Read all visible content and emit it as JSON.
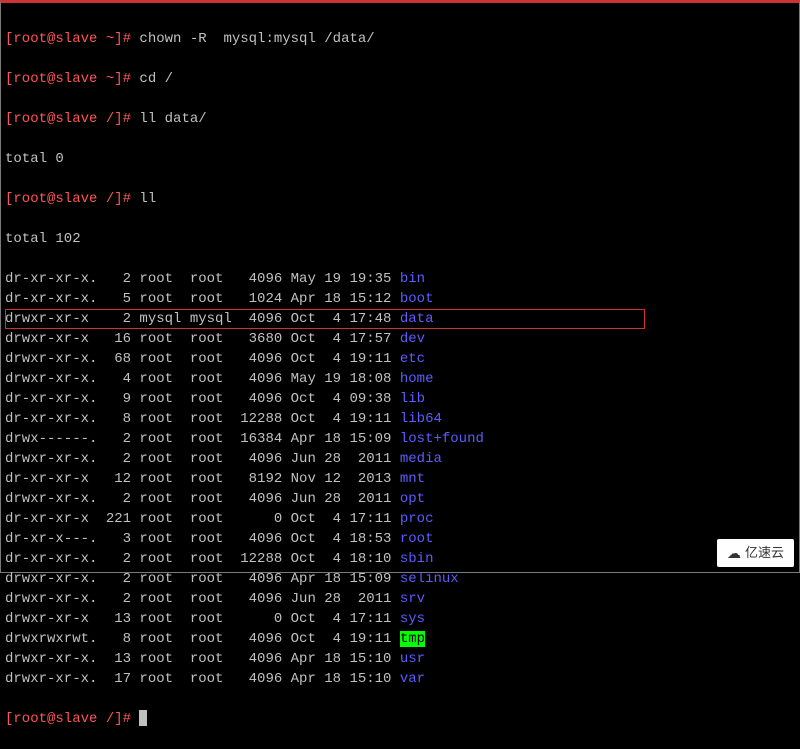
{
  "prompts": [
    {
      "user": "[root@slave ~]#",
      "cmd": " chown -R  mysql:mysql /data/"
    },
    {
      "user": "[root@slave ~]#",
      "cmd": " cd /"
    },
    {
      "user": "[root@slave /]#",
      "cmd": " ll data/"
    }
  ],
  "total_data": "total 0",
  "prompt_ll": {
    "user": "[root@slave /]#",
    "cmd": " ll"
  },
  "total_root": "total 102",
  "rows": [
    {
      "perm": "dr-xr-xr-x.   2 root  root   4096 May 19 19:35 ",
      "name": "bin",
      "cls": "dir"
    },
    {
      "perm": "dr-xr-xr-x.   5 root  root   1024 Apr 18 15:12 ",
      "name": "boot",
      "cls": "dir"
    },
    {
      "perm": "drwxr-xr-x    2 mysql mysql  4096 Oct  4 17:48 ",
      "name": "data",
      "cls": "dir",
      "hl": true
    },
    {
      "perm": "drwxr-xr-x   16 root  root   3680 Oct  4 17:57 ",
      "name": "dev",
      "cls": "dir"
    },
    {
      "perm": "drwxr-xr-x.  68 root  root   4096 Oct  4 19:11 ",
      "name": "etc",
      "cls": "dir"
    },
    {
      "perm": "drwxr-xr-x.   4 root  root   4096 May 19 18:08 ",
      "name": "home",
      "cls": "dir"
    },
    {
      "perm": "dr-xr-xr-x.   9 root  root   4096 Oct  4 09:38 ",
      "name": "lib",
      "cls": "dir"
    },
    {
      "perm": "dr-xr-xr-x.   8 root  root  12288 Oct  4 19:11 ",
      "name": "lib64",
      "cls": "dir"
    },
    {
      "perm": "drwx------.   2 root  root  16384 Apr 18 15:09 ",
      "name": "lost+found",
      "cls": "dir"
    },
    {
      "perm": "drwxr-xr-x.   2 root  root   4096 Jun 28  2011 ",
      "name": "media",
      "cls": "dir"
    },
    {
      "perm": "dr-xr-xr-x   12 root  root   8192 Nov 12  2013 ",
      "name": "mnt",
      "cls": "dir"
    },
    {
      "perm": "drwxr-xr-x.   2 root  root   4096 Jun 28  2011 ",
      "name": "opt",
      "cls": "dir"
    },
    {
      "perm": "dr-xr-xr-x  221 root  root      0 Oct  4 17:11 ",
      "name": "proc",
      "cls": "dir"
    },
    {
      "perm": "dr-xr-x---.   3 root  root   4096 Oct  4 18:53 ",
      "name": "root",
      "cls": "dir"
    },
    {
      "perm": "dr-xr-xr-x.   2 root  root  12288 Oct  4 18:10 ",
      "name": "sbin",
      "cls": "dir"
    },
    {
      "perm": "drwxr-xr-x.   2 root  root   4096 Apr 18 15:09 ",
      "name": "selinux",
      "cls": "dir"
    },
    {
      "perm": "drwxr-xr-x.   2 root  root   4096 Jun 28  2011 ",
      "name": "srv",
      "cls": "dir"
    },
    {
      "perm": "drwxr-xr-x   13 root  root      0 Oct  4 17:11 ",
      "name": "sys",
      "cls": "dir"
    },
    {
      "perm": "drwxrwxrwt.   8 root  root   4096 Oct  4 19:11 ",
      "name": "tmp",
      "cls": "dir-sticky"
    },
    {
      "perm": "drwxr-xr-x.  13 root  root   4096 Apr 18 15:10 ",
      "name": "usr",
      "cls": "dir"
    },
    {
      "perm": "drwxr-xr-x.  17 root  root   4096 Apr 18 15:10 ",
      "name": "var",
      "cls": "dir"
    }
  ],
  "final_prompt": {
    "user": "[root@slave /]#",
    "cmd": " "
  },
  "watermark": "亿速云"
}
